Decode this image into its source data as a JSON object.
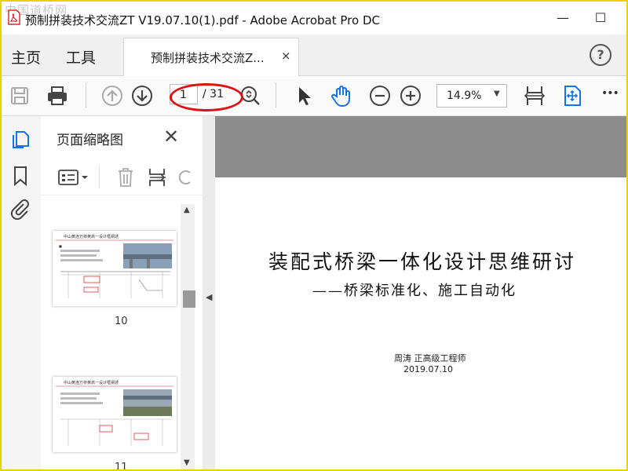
{
  "window": {
    "title": "预制拼装技术交流ZT V19.07.10(1).pdf - Adobe Acrobat Pro DC",
    "watermark": "中国道桥网",
    "minimize": "—",
    "maximize": "☐"
  },
  "menu": {
    "home": "主页",
    "tools": "工具",
    "tab_label": "预制拼装技术交流Z...",
    "tab_close": "×",
    "help": "?"
  },
  "toolbar": {
    "page_current": "1",
    "page_total": "/ 31",
    "zoom": "14.9%",
    "zoom_caret": "▼",
    "more": "•••"
  },
  "panel": {
    "title": "页面缩略图",
    "close": "✕",
    "thumbnails": [
      {
        "number": "10",
        "heading": "中山黄连万桥黄高一设计框阐述"
      },
      {
        "number": "11",
        "heading": "中山黄连万桥黄高一设计框阐述"
      }
    ]
  },
  "document": {
    "title": "装配式桥梁一体化设计思维研讨",
    "subtitle": "——桥梁标准化、施工自动化",
    "author": "周涛   正高级工程师",
    "date": "2019.07.10"
  },
  "colors": {
    "accent_blue": "#1473e6",
    "annotation_red": "#d11111",
    "frame_yellow": "#e8d200"
  }
}
